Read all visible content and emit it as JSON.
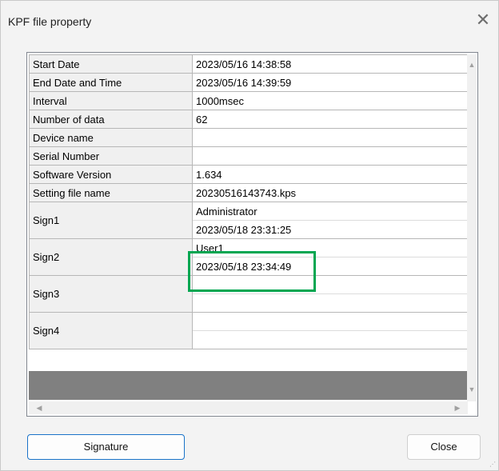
{
  "window": {
    "title": "KPF file property",
    "close_icon": "close-icon"
  },
  "properties": [
    {
      "label": "Start Date",
      "values": [
        "2023/05/16 14:38:58"
      ]
    },
    {
      "label": "End Date and Time",
      "values": [
        "2023/05/16 14:39:59"
      ]
    },
    {
      "label": "Interval",
      "values": [
        "1000msec"
      ]
    },
    {
      "label": "Number of data",
      "values": [
        "62"
      ]
    },
    {
      "label": "Device name",
      "values": [
        ""
      ]
    },
    {
      "label": "Serial Number",
      "values": [
        ""
      ]
    },
    {
      "label": "Software Version",
      "values": [
        "1.634"
      ]
    },
    {
      "label": "Setting file name",
      "values": [
        "20230516143743.kps"
      ]
    },
    {
      "label": "Sign1",
      "values": [
        "Administrator",
        "2023/05/18 23:31:25"
      ]
    },
    {
      "label": "Sign2",
      "values": [
        "User1",
        "2023/05/18 23:34:49"
      ]
    },
    {
      "label": "Sign3",
      "values": [
        "",
        ""
      ]
    },
    {
      "label": "Sign4",
      "values": [
        "",
        ""
      ]
    }
  ],
  "buttons": {
    "signature": "Signature",
    "close": "Close"
  },
  "highlight_color": "#00a651"
}
